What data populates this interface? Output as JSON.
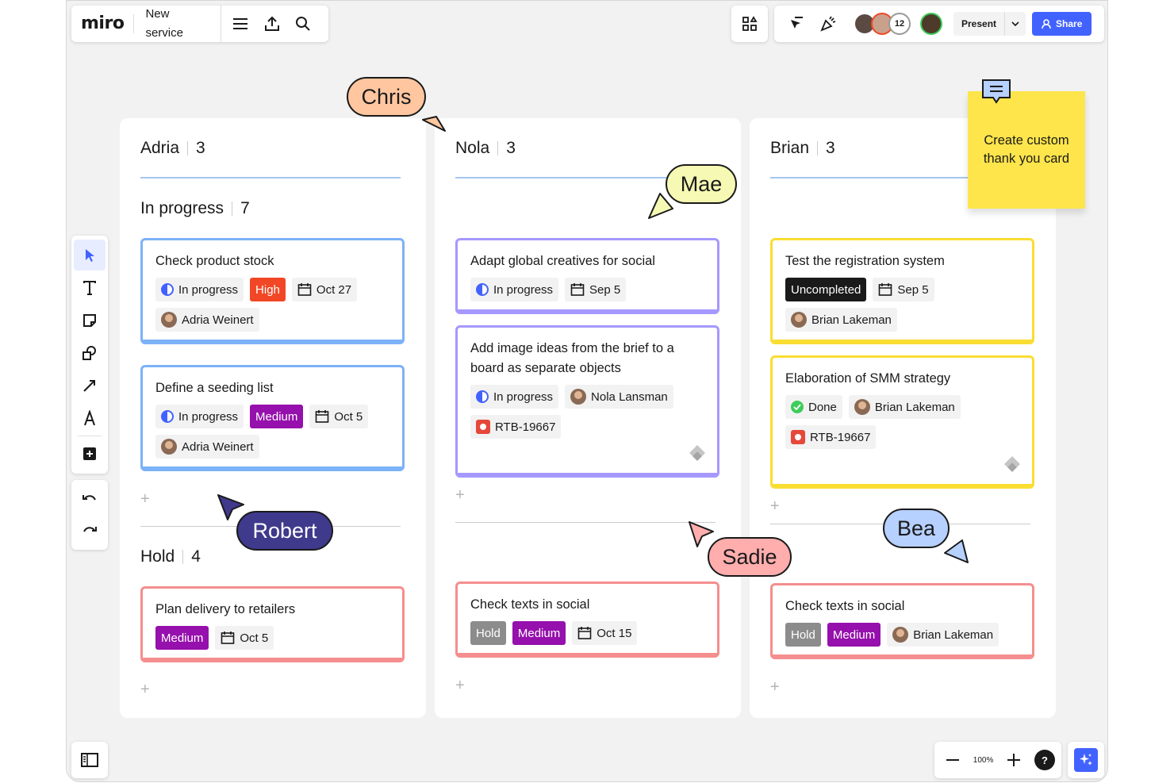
{
  "app": {
    "logo": "miro",
    "board_name": "New service"
  },
  "topbar": {
    "collaborator_count": "12",
    "present_label": "Present",
    "share_label": "Share"
  },
  "zoom": {
    "level": "100%",
    "help": "?"
  },
  "columns": [
    {
      "owner": "Adria",
      "count": "3",
      "groups": [
        {
          "name": "In progress",
          "count": "7"
        },
        {
          "name": "Hold",
          "count": "4"
        }
      ],
      "cards": [
        {
          "title": "Check product stock",
          "status": "In progress",
          "priority": "High",
          "date": "Oct 27",
          "assignee": "Adria Weinert"
        },
        {
          "title": "Define a seeding list",
          "status": "In progress",
          "priority": "Medium",
          "date": "Oct 5",
          "assignee": "Adria Weinert"
        },
        {
          "title": "Plan delivery to retailers",
          "priority": "Medium",
          "date": "Oct 5"
        }
      ]
    },
    {
      "owner": "Nola",
      "count": "3",
      "cards": [
        {
          "title": "Adapt global creatives for social",
          "status": "In progress",
          "date": "Sep 5"
        },
        {
          "title": "Add image ideas from the brief to a board as separate objects",
          "status": "In progress",
          "assignee": "Nola Lansman",
          "ticket": "RTB-19667"
        },
        {
          "title": "Check texts in social",
          "status": "Hold",
          "priority": "Medium",
          "date": "Oct 15"
        }
      ]
    },
    {
      "owner": "Brian",
      "count": "3",
      "cards": [
        {
          "title": "Test the registration system",
          "status": "Uncompleted",
          "date": "Sep 5",
          "assignee": "Brian Lakeman"
        },
        {
          "title": "Elaboration of SMM strategy",
          "status": "Done",
          "assignee": "Brian Lakeman",
          "ticket": "RTB-19667"
        },
        {
          "title": "Check texts in social",
          "status": "Hold",
          "priority": "Medium",
          "assignee": "Brian Lakeman"
        }
      ]
    }
  ],
  "cursors": [
    {
      "name": "Chris",
      "color": "#ffc6a0"
    },
    {
      "name": "Mae",
      "color": "#f6f9b3"
    },
    {
      "name": "Robert",
      "color": "#3f3a8c"
    },
    {
      "name": "Sadie",
      "color": "#ffadad"
    },
    {
      "name": "Bea",
      "color": "#b6d0ff"
    }
  ],
  "sticky_note": {
    "text": "Create custom thank you card",
    "color": "#fee54b"
  },
  "colors": {
    "accent": "#4262ff",
    "high": "#f24726",
    "medium": "#9510ac"
  }
}
